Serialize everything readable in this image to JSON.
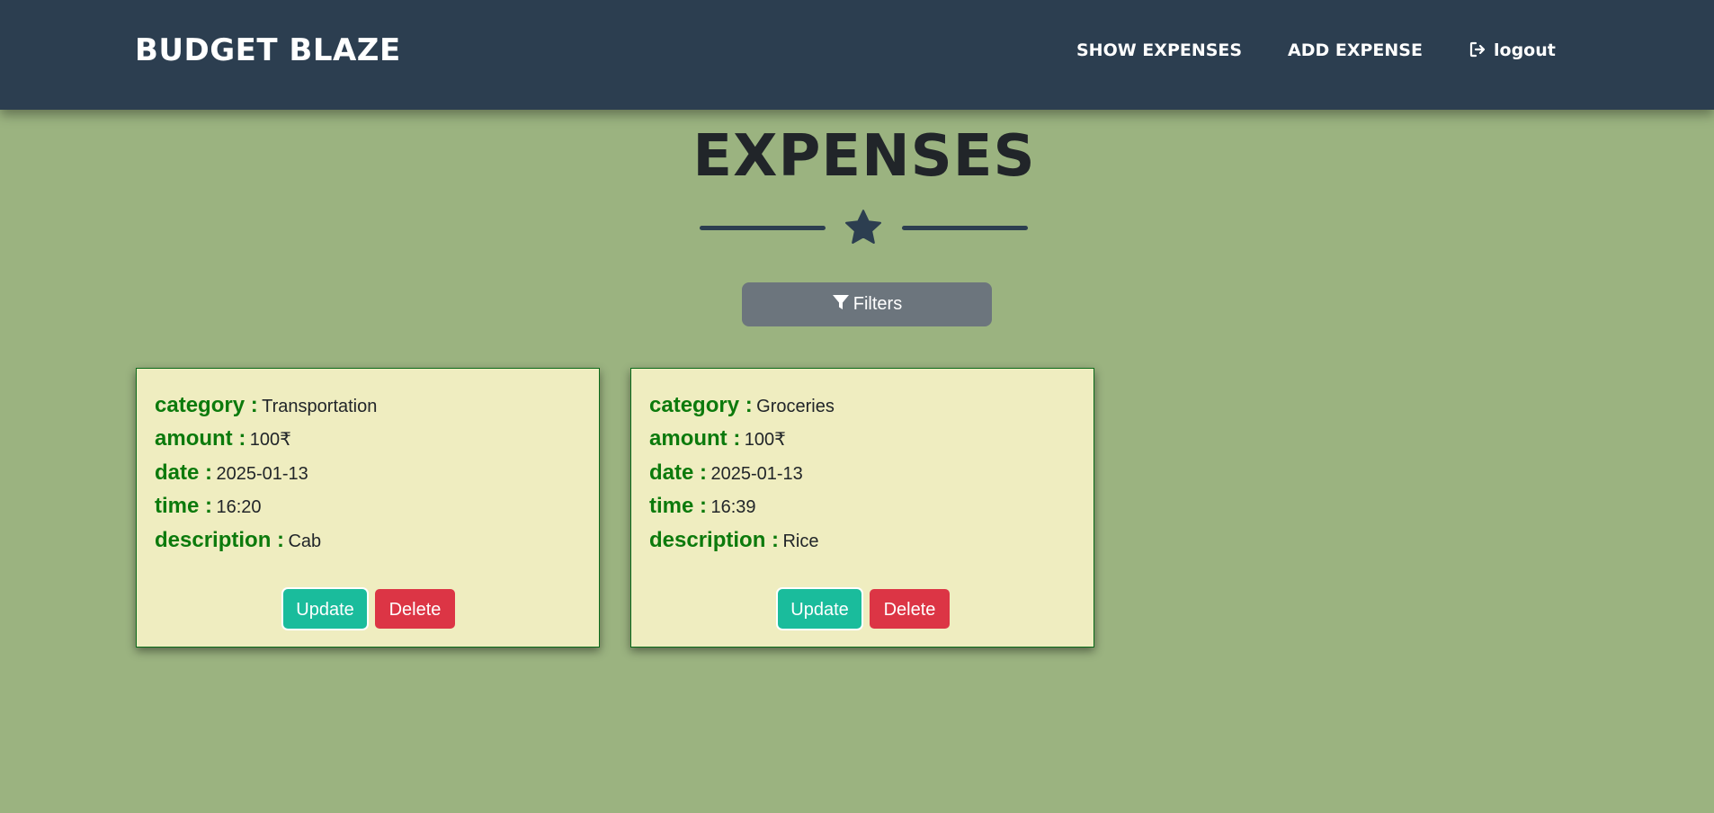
{
  "navbar": {
    "brand": "BUDGET BLAZE",
    "links": {
      "show_expenses": "SHOW EXPENSES",
      "add_expense": "ADD EXPENSE",
      "logout": "logout"
    }
  },
  "page": {
    "title": "EXPENSES",
    "filters_label": "Filters"
  },
  "labels": {
    "category": "category :",
    "amount": "amount :",
    "date": "date :",
    "time": "time :",
    "description": "description :"
  },
  "expenses": [
    {
      "category": "Transportation",
      "amount": "100₹",
      "date": "2025-01-13",
      "time": "16:20",
      "description": "Cab",
      "update_label": "Update",
      "delete_label": "Delete"
    },
    {
      "category": "Groceries",
      "amount": "100₹",
      "date": "2025-01-13",
      "time": "16:39",
      "description": "Rice",
      "update_label": "Update",
      "delete_label": "Delete"
    }
  ],
  "colors": {
    "background": "#9bb380",
    "navbar": "#2c3e50",
    "card_background": "#efedc0",
    "label_green": "#0c7a0c",
    "update_button": "#1abc9c",
    "delete_button": "#dc3545",
    "filters_button": "#6c757d"
  },
  "icons": {
    "logout": "logout-icon",
    "divider": "star-icon",
    "filters": "filter-icon"
  }
}
